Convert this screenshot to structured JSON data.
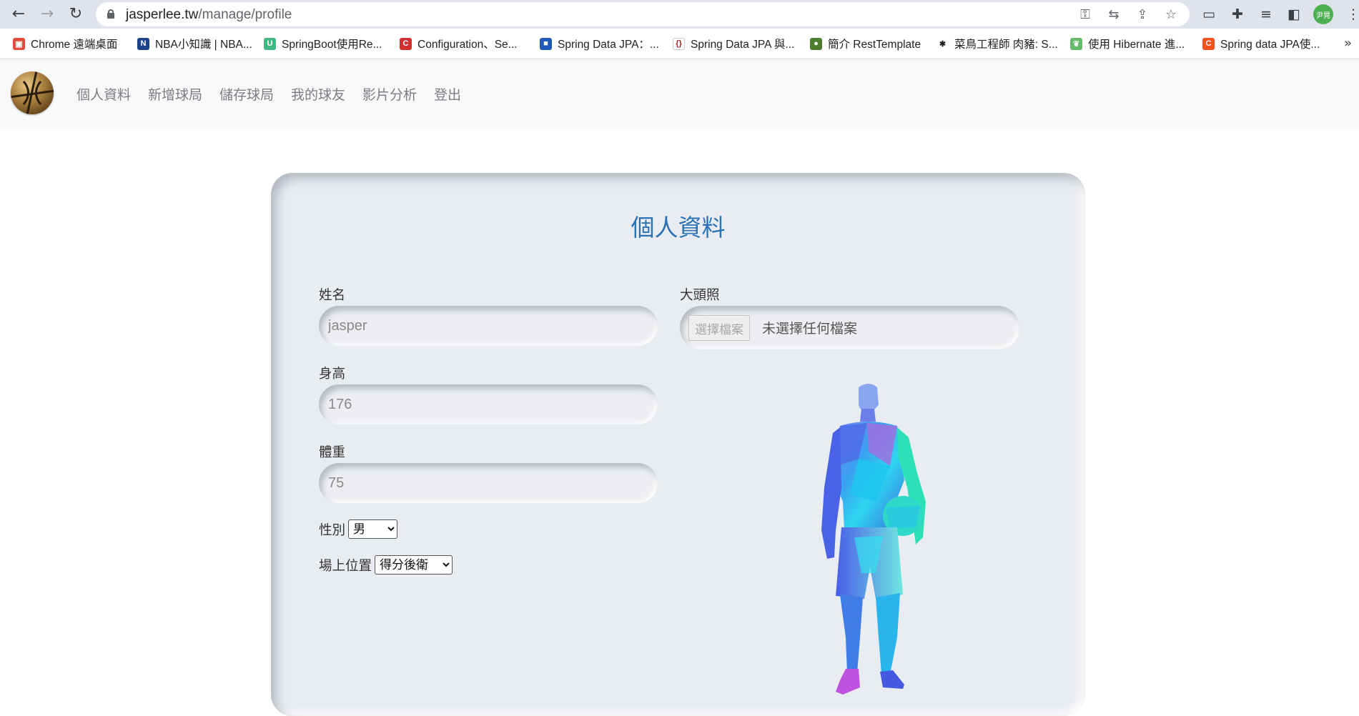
{
  "browser": {
    "url_host": "jasperlee.tw",
    "url_path": "/manage/profile",
    "profile_label": "尹晃"
  },
  "bookmarks": [
    {
      "label": "Chrome 遠端桌面",
      "icon_color": "#e34a3b"
    },
    {
      "label": "NBA小知識 | NBA...",
      "icon_color": "#1d428a"
    },
    {
      "label": "SpringBoot使用Re...",
      "icon_color": "#41b883"
    },
    {
      "label": "Configuration、Se...",
      "icon_color": "#d32f2f"
    },
    {
      "label": "Spring Data JPA：...",
      "icon_color": "#1e5bb8"
    },
    {
      "label": "Spring Data JPA 與...",
      "icon_color": "#b71c1c"
    },
    {
      "label": "簡介 RestTemplate",
      "icon_color": "#4e7d2f"
    },
    {
      "label": "菜鳥工程師 肉豬: S...",
      "icon_color": "#222222"
    },
    {
      "label": "使用 Hibernate 進...",
      "icon_color": "#66bb6a"
    },
    {
      "label": "Spring data JPA使...",
      "icon_color": "#f4511e"
    }
  ],
  "site_nav": {
    "links": [
      "個人資料",
      "新增球局",
      "儲存球局",
      "我的球友",
      "影片分析",
      "登出"
    ]
  },
  "profile": {
    "title": "個人資料",
    "name_label": "姓名",
    "name_value": "jasper",
    "height_label": "身高",
    "height_value": "176",
    "weight_label": "體重",
    "weight_value": "75",
    "gender_label": "性別",
    "gender_value": "男",
    "position_label": "場上位置",
    "position_value": "得分後衛",
    "avatar_label": "大頭照",
    "file_button_label": "選擇檔案",
    "file_status": "未選擇任何檔案"
  },
  "colors": {
    "title_blue": "#2a72b5",
    "card_bg": "#e9ecf0",
    "nav_bg": "#f8f9fb"
  }
}
